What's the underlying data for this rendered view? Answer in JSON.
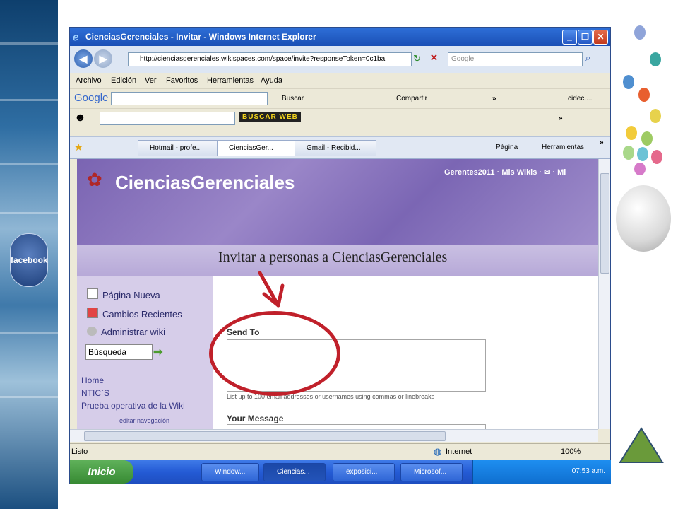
{
  "slide": {
    "left_badge": "facebook",
    "accent_red": "#c0202a",
    "nav_triangle_color": "#6a9a3a"
  },
  "window": {
    "title": "CienciasGerenciales - Invitar - Windows Internet Explorer",
    "min_icon": "minimize-icon",
    "max_icon": "maximize-icon",
    "close_icon": "close-icon"
  },
  "address": {
    "url": "http://cienciasgerenciales.wikispaces.com/space/invite?responseToken=0c1ba",
    "search_placeholder": "Google"
  },
  "menu": [
    "Archivo",
    "Edición",
    "Ver",
    "Favoritos",
    "Herramientas",
    "Ayuda"
  ],
  "google_toolbar": {
    "logo": "Google",
    "search_label": "Buscar",
    "share_label": "Compartir",
    "more": "»",
    "user": "cidec...."
  },
  "second_toolbar": {
    "buscaweb_label": "BUSCAR WEB",
    "more": "»"
  },
  "tabs": [
    {
      "label": "Hotmail - profe...",
      "active": false
    },
    {
      "label": "CienciasGer...",
      "active": true
    },
    {
      "label": "Gmail - Recibid...",
      "active": false
    }
  ],
  "command_bar": {
    "page_label": "Página",
    "tools_label": "Herramientas",
    "more": "»"
  },
  "site": {
    "title": "CienciasGerenciales",
    "user_links": "Gerentes2011 · Mis Wikis · ✉ · Mi",
    "invite_heading": "Invitar a personas a CienciasGerenciales"
  },
  "sidebar": {
    "actions": [
      "Página Nueva",
      "Cambios Recientes",
      "Administrar wiki"
    ],
    "search_value": "Búsqueda",
    "nav": [
      "Home",
      "NTIC`S",
      "Prueba operativa de la Wiki"
    ],
    "edit_nav": "editar navegación"
  },
  "form": {
    "send_to_label": "Send To",
    "send_to_value": "",
    "send_to_hint": "List up to 100 email addresses or usernames using commas or linebreaks",
    "message_label": "Your Message"
  },
  "status": {
    "text": "Listo",
    "zone": "Internet",
    "zoom": "100%"
  },
  "taskbar": {
    "start": "Inicio",
    "buttons": [
      "Window...",
      "Ciencias...",
      "exposici...",
      "Microsof..."
    ],
    "clock": "07:53 a.m."
  }
}
